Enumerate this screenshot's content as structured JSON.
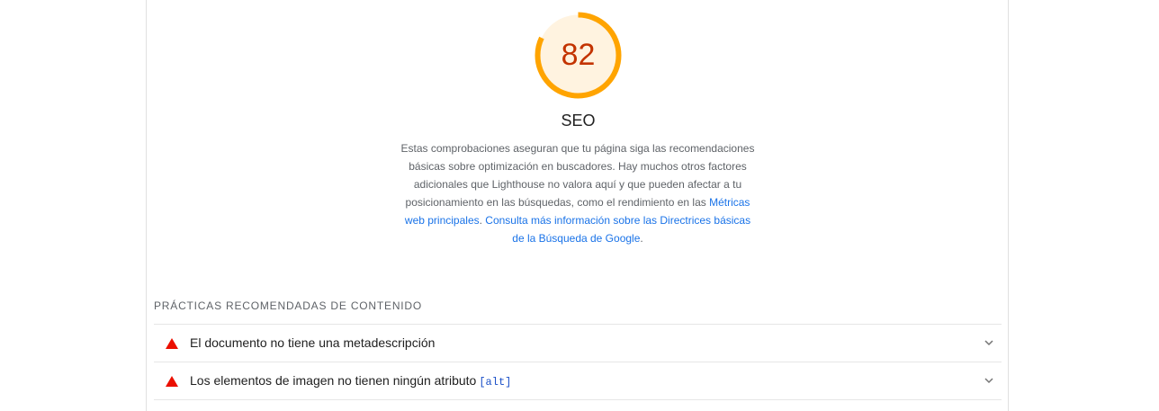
{
  "category": {
    "score": "82",
    "score_fraction": 0.82,
    "title": "SEO",
    "description_text": "Estas comprobaciones aseguran que tu página siga las recomendaciones básicas sobre optimización en buscadores. Hay muchos otros factores adicionales que Lighthouse no valora aquí y que pueden afectar a tu posicionamiento en las búsquedas, como el rendimiento en las ",
    "link1": "Métricas web principales",
    "link2": "Consulta más información sobre las Directrices básicas de la Búsqueda de Google",
    "description_end": ".",
    "colors": {
      "gauge_stroke": "#ffa400",
      "gauge_fill": "#fff3e0",
      "score_text": "#c33300",
      "link": "#1a73e8",
      "fail": "#eb0f00"
    }
  },
  "group": {
    "title": "PRÁCTICAS RECOMENDADAS DE CONTENIDO"
  },
  "audits": [
    {
      "title": "El documento no tiene una metadescripción",
      "code": "",
      "icon": "fail-triangle-icon"
    },
    {
      "title": "Los elementos de imagen no tienen ningún atributo",
      "code": "[alt]",
      "icon": "fail-triangle-icon"
    }
  ]
}
